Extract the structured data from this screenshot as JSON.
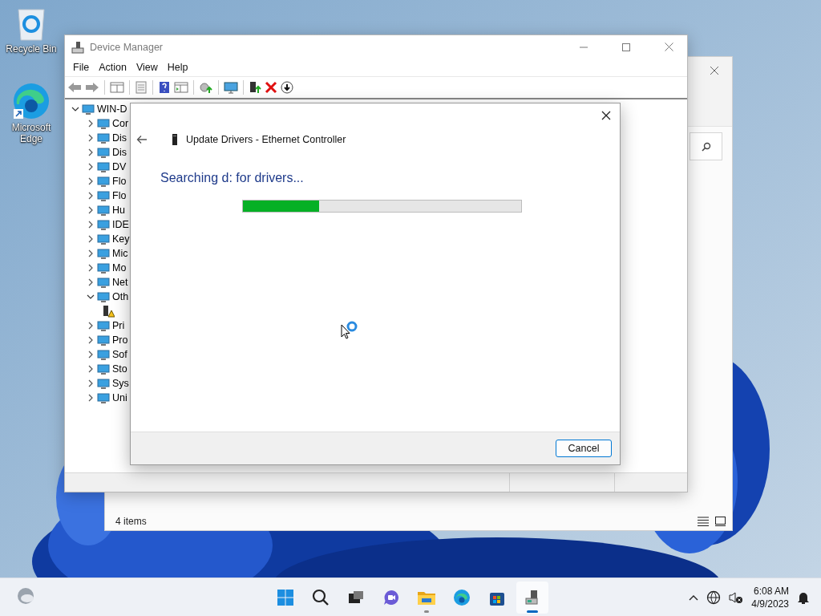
{
  "desktop_icons": [
    {
      "label": "Recycle Bin",
      "kind": "bin"
    },
    {
      "label": "Microsoft Edge",
      "kind": "edge"
    }
  ],
  "back_window": {
    "status": "4 items"
  },
  "device_manager": {
    "title": "Device Manager",
    "menu": [
      "File",
      "Action",
      "View",
      "Help"
    ],
    "tree": {
      "label": "WIN-D",
      "expanded": true,
      "children": [
        {
          "label": "Cor",
          "expanded": false
        },
        {
          "label": "Dis",
          "expanded": false
        },
        {
          "label": "Dis",
          "expanded": false
        },
        {
          "label": "DV",
          "expanded": false
        },
        {
          "label": "Flo",
          "expanded": false
        },
        {
          "label": "Flo",
          "expanded": false
        },
        {
          "label": "Hu",
          "expanded": false
        },
        {
          "label": "IDE",
          "expanded": false
        },
        {
          "label": "Key",
          "expanded": false
        },
        {
          "label": "Mic",
          "expanded": false
        },
        {
          "label": "Mo",
          "expanded": false
        },
        {
          "label": "Net",
          "expanded": false
        },
        {
          "label": "Oth",
          "expanded": true,
          "children": [
            {
              "warning": true
            }
          ]
        },
        {
          "label": "Pri",
          "expanded": false
        },
        {
          "label": "Pro",
          "expanded": false
        },
        {
          "label": "Sof",
          "expanded": false
        },
        {
          "label": "Sto",
          "expanded": false
        },
        {
          "label": "Sys",
          "expanded": false
        },
        {
          "label": "Uni",
          "expanded": false
        }
      ]
    }
  },
  "dialog": {
    "title": "Update Drivers - Ethernet Controller",
    "message": "Searching d: for drivers...",
    "progress": {
      "level": 0.275
    },
    "buttons": [
      "Cancel"
    ]
  },
  "taskbar": {
    "apps": [
      {
        "kind": "start",
        "running": false,
        "selected": false
      },
      {
        "kind": "search",
        "running": false,
        "selected": false
      },
      {
        "kind": "taskview",
        "running": false,
        "selected": false
      },
      {
        "kind": "chat",
        "running": false,
        "selected": false
      },
      {
        "kind": "folder",
        "running": true,
        "selected": false
      },
      {
        "kind": "edge",
        "running": false,
        "selected": false
      },
      {
        "kind": "store",
        "running": false,
        "selected": false
      },
      {
        "kind": "devmgr",
        "running": true,
        "selected": true
      }
    ],
    "time": "6:08 AM",
    "date": "4/9/2023"
  }
}
